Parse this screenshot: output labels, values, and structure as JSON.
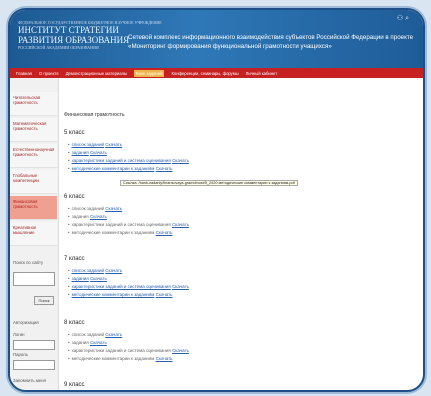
{
  "logo": {
    "tagline": "ФЕДЕРАЛЬНОЕ ГОСУДАРСТВЕННОЕ БЮДЖЕТНОЕ НАУЧНОЕ УЧРЕЖДЕНИЕ",
    "line1": "ИНСТИТУТ СТРАТЕГИИ",
    "line2": "РАЗВИТИЯ ОБРАЗОВАНИЯ",
    "line3": "РОССИЙСКОЙ АКАДЕМИИ ОБРАЗОВАНИЯ"
  },
  "header": {
    "text": "Сетевой комплекс информационного взаимодействия субъектов Российской Федерации в проекте «Мониторинг формирования функциональной грамотности учащихся»"
  },
  "nav": {
    "items": [
      "Главная",
      "О проекте",
      "Демонстрационные материалы",
      "Банк заданий",
      "Конференции, семинары, форумы",
      "Личный кабинет"
    ],
    "active": "Банк заданий"
  },
  "sidebar": {
    "items": [
      "Читательская грамотность",
      "Математическая грамотность",
      "Естественнонаучная грамотность",
      "Глобальные компетенции",
      "Финансовая грамотность",
      "Креативное мышление"
    ],
    "search_label": "Поиск по сайту",
    "search_button": "Поиск",
    "auth_label": "Авторизация",
    "login_label": "Логин",
    "password_label": "Пароль",
    "remember_label": "Запомнить меня"
  },
  "content": {
    "page_title": "Финансовая грамотность",
    "grades": [
      {
        "title": "5 класс",
        "items": [
          {
            "name": "список заданий",
            "link": "Скачать",
            "linked_name": true
          },
          {
            "name": "задания",
            "link": "Скачать",
            "linked_name": true
          },
          {
            "name": "характеристики заданий и система оценивания",
            "link": "Скачать",
            "linked_name": true
          },
          {
            "name": "методические комментарии к заданиям",
            "link": "Скачать",
            "linked_name": true
          }
        ]
      },
      {
        "title": "6 класс",
        "items": [
          {
            "name": "список заданий",
            "link": "Скачать",
            "linked_name": false
          },
          {
            "name": "задания",
            "link": "Скачать",
            "linked_name": false
          },
          {
            "name": "характеристики заданий и система оценивания",
            "link": "Скачать",
            "linked_name": false
          },
          {
            "name": "методические комментарии к заданиям",
            "link": "Скачать",
            "linked_name": false
          }
        ]
      },
      {
        "title": "7 класс",
        "items": [
          {
            "name": "список заданий",
            "link": "Скачать",
            "linked_name": true
          },
          {
            "name": "задания",
            "link": "Скачать",
            "linked_name": true
          },
          {
            "name": "характеристики заданий и система оценивания",
            "link": "Скачать",
            "linked_name": true
          },
          {
            "name": "методические комментарии к заданиям",
            "link": "Скачать",
            "linked_name": true
          }
        ]
      },
      {
        "title": "8 класс",
        "items": [
          {
            "name": "список заданий",
            "link": "Скачать",
            "linked_name": false
          },
          {
            "name": "задания",
            "link": "Скачать",
            "linked_name": false
          },
          {
            "name": "характеристики заданий и система оценивания",
            "link": "Скачать",
            "linked_name": false
          },
          {
            "name": "методические комментарии к заданиям",
            "link": "Скачать",
            "linked_name": false
          }
        ]
      },
      {
        "title": "9 класс",
        "items": []
      }
    ],
    "tooltip": "Ссылка: /bank-zadaniy/finansovaya-gramotnost/5_2020 методические комментарии к заданиям.pdf"
  }
}
